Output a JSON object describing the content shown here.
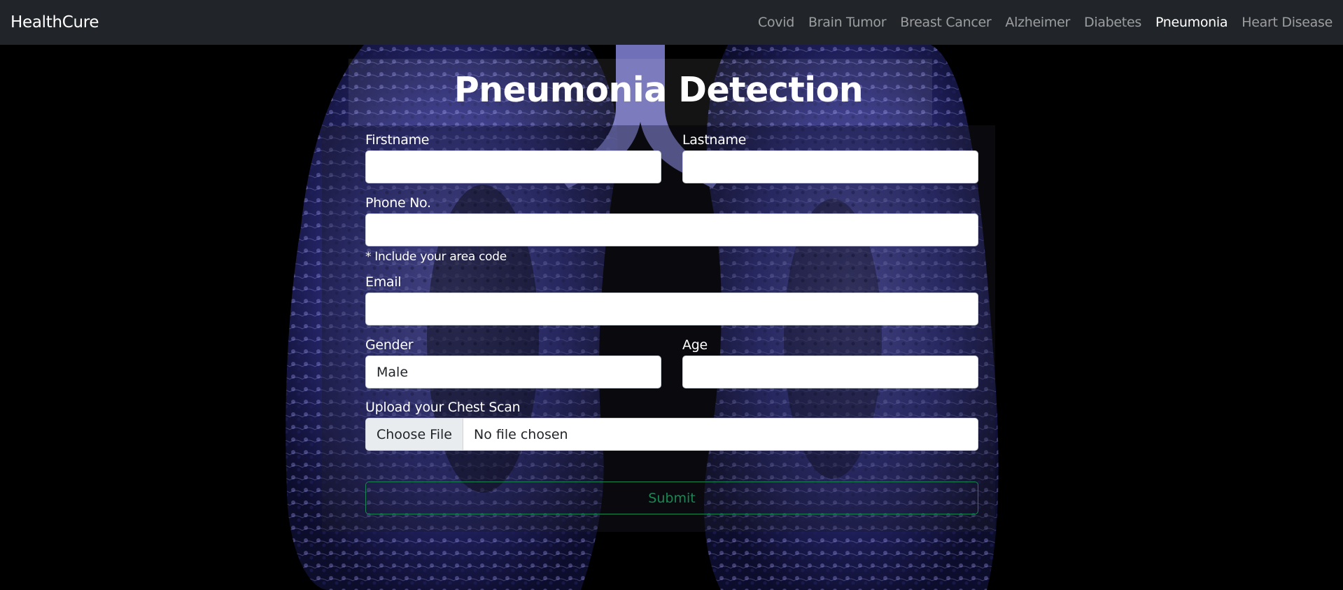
{
  "navbar": {
    "brand": "HealthCure",
    "links": [
      {
        "label": "Covid",
        "active": false
      },
      {
        "label": "Brain Tumor",
        "active": false
      },
      {
        "label": "Breast Cancer",
        "active": false
      },
      {
        "label": "Alzheimer",
        "active": false
      },
      {
        "label": "Diabetes",
        "active": false
      },
      {
        "label": "Pneumonia",
        "active": true
      },
      {
        "label": "Heart Disease",
        "active": false
      }
    ]
  },
  "form": {
    "title": "Pneumonia Detection",
    "firstname": {
      "label": "Firstname",
      "value": ""
    },
    "lastname": {
      "label": "Lastname",
      "value": ""
    },
    "phone": {
      "label": "Phone No.",
      "value": "",
      "hint": "* Include your area code"
    },
    "email": {
      "label": "Email",
      "value": ""
    },
    "gender": {
      "label": "Gender",
      "value": "Male"
    },
    "age": {
      "label": "Age",
      "value": ""
    },
    "upload": {
      "label": "Upload your Chest Scan",
      "button": "Choose File",
      "status": "No file chosen"
    },
    "submit": "Submit"
  },
  "colors": {
    "navbar_bg": "#212529",
    "submit_accent": "#198754",
    "lung_tint": "#4a4ac8"
  },
  "icons": {
    "background": "lung-scan-image"
  }
}
